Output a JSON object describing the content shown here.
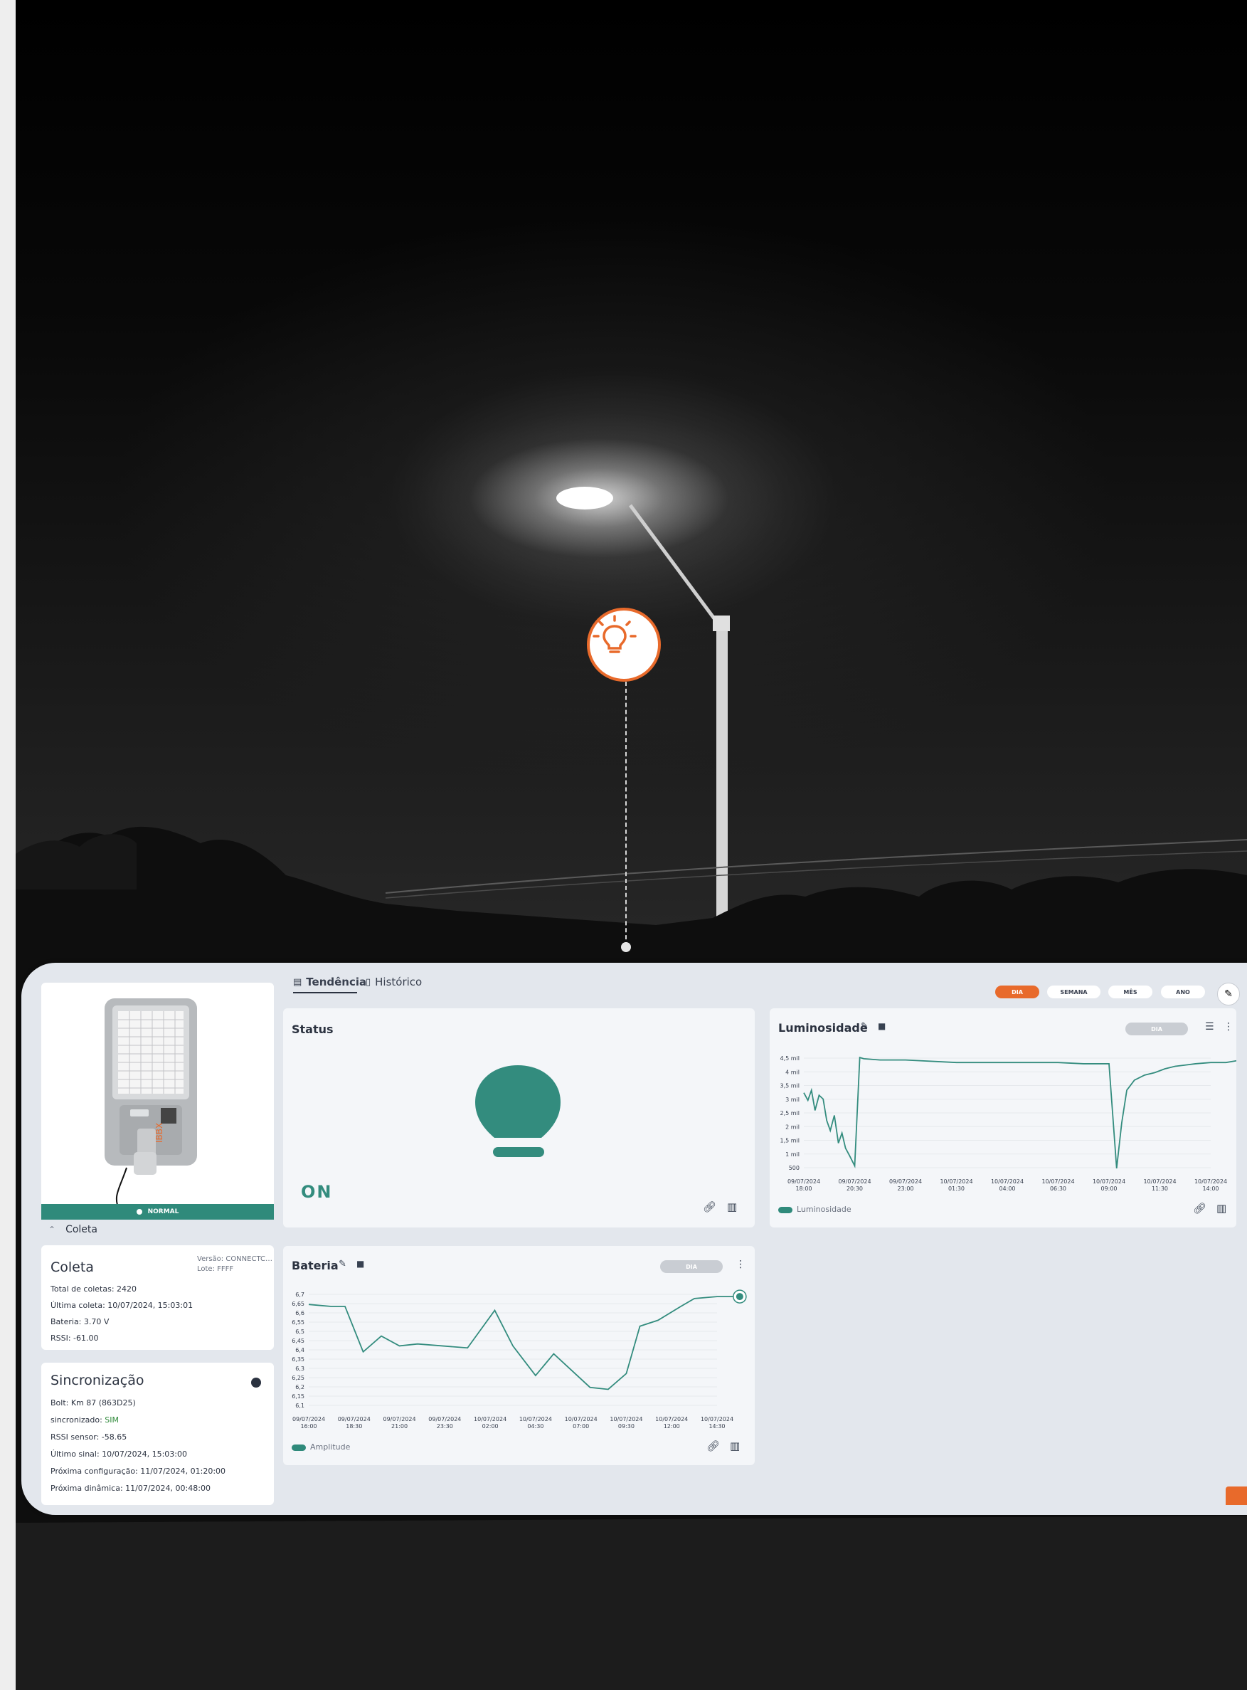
{
  "tabs": [
    {
      "label": "Tendência"
    },
    {
      "label": "Histórico"
    }
  ],
  "period_buttons": [
    "DIA",
    "SEMANA",
    "MÊS",
    "ANO"
  ],
  "device": {
    "status_badge": "NORMAL",
    "collapse_label": "Coleta"
  },
  "coleta": {
    "title": "Coleta",
    "version": "Versão: CONNECTCUB...",
    "lote": "Lote: FFFF",
    "lines": [
      "Total de coletas: 2420",
      "Última coleta: 10/07/2024, 15:03:01",
      "Bateria: 3.70 V",
      "RSSI: -61.00"
    ]
  },
  "sync": {
    "title": "Sincronização",
    "lines": [
      {
        "label": "Bolt: Km 87 (863D25)"
      },
      {
        "label": "sincronizado: ",
        "value": "SIM"
      },
      {
        "label": "RSSI sensor: -58.65"
      },
      {
        "label": "Último sinal: 10/07/2024, 15:03:00"
      },
      {
        "label": "Próxima configuração: 11/07/2024, 01:20:00"
      },
      {
        "label": "Próxima dinâmica: 11/07/2024, 00:48:00"
      }
    ]
  },
  "status_card": {
    "title": "Status",
    "value": "ON"
  },
  "colors": {
    "accent": "#e86a2b",
    "teal": "#2f8a7b"
  },
  "chart_data": [
    {
      "type": "line",
      "title": "Luminosidade",
      "period": "DIA",
      "legend": "Luminosidade",
      "yticks": [
        "4,5 mil",
        "4 mil",
        "3,5 mil",
        "3 mil",
        "2,5 mil",
        "2 mil",
        "1,5 mil",
        "1 mil",
        "500"
      ],
      "ylim": [
        0,
        4800
      ],
      "xticks": [
        "09/07/2024\n18:00",
        "09/07/2024\n20:30",
        "09/07/2024\n23:00",
        "10/07/2024\n01:30",
        "10/07/2024\n04:00",
        "10/07/2024\n06:30",
        "10/07/2024\n09:00",
        "10/07/2024\n11:30",
        "10/07/2024\n14:00"
      ],
      "x": [
        0,
        0.08,
        0.15,
        0.22,
        0.3,
        0.38,
        0.45,
        0.52,
        0.6,
        0.68,
        0.75,
        0.82,
        0.9,
        1.0,
        1.1,
        1.18,
        1.5,
        2.0,
        3.0,
        3.5,
        4.0,
        4.6,
        5.0,
        5.5,
        6.0,
        6.15,
        6.25,
        6.35,
        6.5,
        6.7,
        6.9,
        7.1,
        7.3,
        7.5,
        7.7,
        8.0,
        8.3,
        8.6,
        8.9,
        9.1,
        9.2
      ],
      "values": [
        3200,
        2900,
        3300,
        2500,
        3100,
        2950,
        2100,
        1700,
        2300,
        1200,
        1600,
        1000,
        700,
        300,
        4600,
        4550,
        4500,
        4500,
        4400,
        4400,
        4400,
        4400,
        4400,
        4350,
        4350,
        200,
        2000,
        3300,
        3700,
        3900,
        4000,
        4150,
        4250,
        4300,
        4350,
        4400,
        4400,
        4500,
        4500,
        4300,
        4450
      ]
    },
    {
      "type": "line",
      "title": "Bateria",
      "period": "DIA",
      "legend": "Amplitude",
      "yticks": [
        "6,7",
        "6,65",
        "6,6",
        "6,55",
        "6,5",
        "6,45",
        "6,4",
        "6,35",
        "6,3",
        "6,25",
        "6,2",
        "6,15",
        "6,1"
      ],
      "ylim": [
        6.09,
        6.71
      ],
      "xticks": [
        "09/07/2024\n16:00",
        "09/07/2024\n18:30",
        "09/07/2024\n21:00",
        "09/07/2024\n23:30",
        "10/07/2024\n02:00",
        "10/07/2024\n04:30",
        "10/07/2024\n07:00",
        "10/07/2024\n09:30",
        "10/07/2024\n12:00",
        "10/07/2024\n14:30"
      ],
      "x": [
        0,
        0.5,
        0.8,
        1.2,
        1.6,
        2.0,
        2.4,
        3.5,
        4.1,
        4.5,
        5.0,
        5.4,
        6.2,
        6.6,
        7.0,
        7.3,
        7.7,
        8.2,
        8.5,
        9.0,
        9.5
      ],
      "values": [
        6.63,
        6.62,
        6.62,
        6.39,
        6.47,
        6.42,
        6.43,
        6.41,
        6.6,
        6.42,
        6.27,
        6.38,
        6.21,
        6.2,
        6.28,
        6.52,
        6.55,
        6.62,
        6.66,
        6.67,
        6.67
      ]
    }
  ]
}
